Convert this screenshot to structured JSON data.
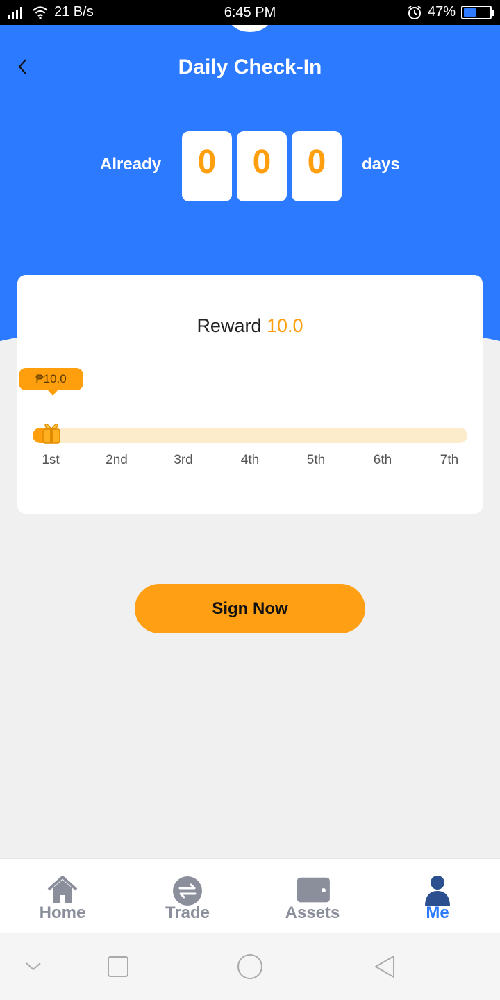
{
  "status_bar": {
    "network_speed": "21 B/s",
    "time": "6:45 PM",
    "battery_percent": "47%",
    "battery_level": 0.47
  },
  "header": {
    "title": "Daily Check-In",
    "counter_prefix": "Already",
    "counter_suffix": "days",
    "digits": [
      "0",
      "0",
      "0"
    ]
  },
  "reward_card": {
    "reward_label": "Reward",
    "reward_value": "10.0",
    "tooltip": "₱10.0",
    "progress_fraction": 0.04,
    "days": [
      "1st",
      "2nd",
      "3rd",
      "4th",
      "5th",
      "6th",
      "7th"
    ]
  },
  "actions": {
    "sign_label": "Sign Now"
  },
  "tabs": [
    {
      "label": "Home",
      "icon": "home-icon",
      "active": false
    },
    {
      "label": "Trade",
      "icon": "exchange-icon",
      "active": false
    },
    {
      "label": "Assets",
      "icon": "wallet-icon",
      "active": false
    },
    {
      "label": "Me",
      "icon": "person-icon",
      "active": true
    }
  ],
  "colors": {
    "primary_blue": "#2c7aff",
    "accent_orange": "#ff9f0d",
    "tab_inactive": "#8b8f9c"
  }
}
